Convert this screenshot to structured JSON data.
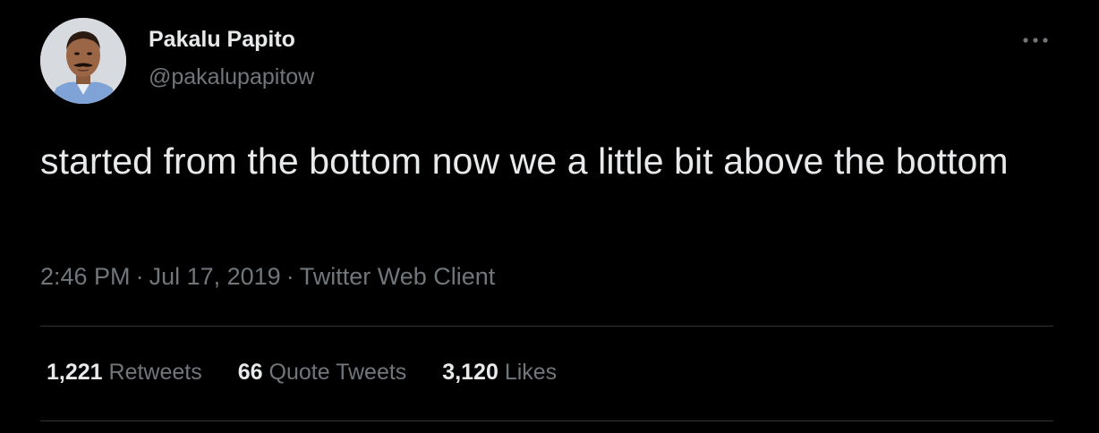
{
  "user": {
    "display_name": "Pakalu Papito",
    "handle": "@pakalupapitow"
  },
  "tweet": {
    "text": "started from the bottom now we a little bit above the bottom",
    "time": "2:46 PM",
    "separator": "·",
    "date": "Jul 17, 2019",
    "source": "Twitter Web Client"
  },
  "stats": {
    "retweets": {
      "count": "1,221",
      "label": "Retweets"
    },
    "quote_tweets": {
      "count": "66",
      "label": "Quote Tweets"
    },
    "likes": {
      "count": "3,120",
      "label": "Likes"
    }
  },
  "icons": {
    "more": "more-options-icon",
    "avatar": "profile-avatar"
  },
  "colors": {
    "background": "#000000",
    "primary_text": "#e7e9ea",
    "secondary_text": "#71767b",
    "divider": "#2f3336"
  }
}
